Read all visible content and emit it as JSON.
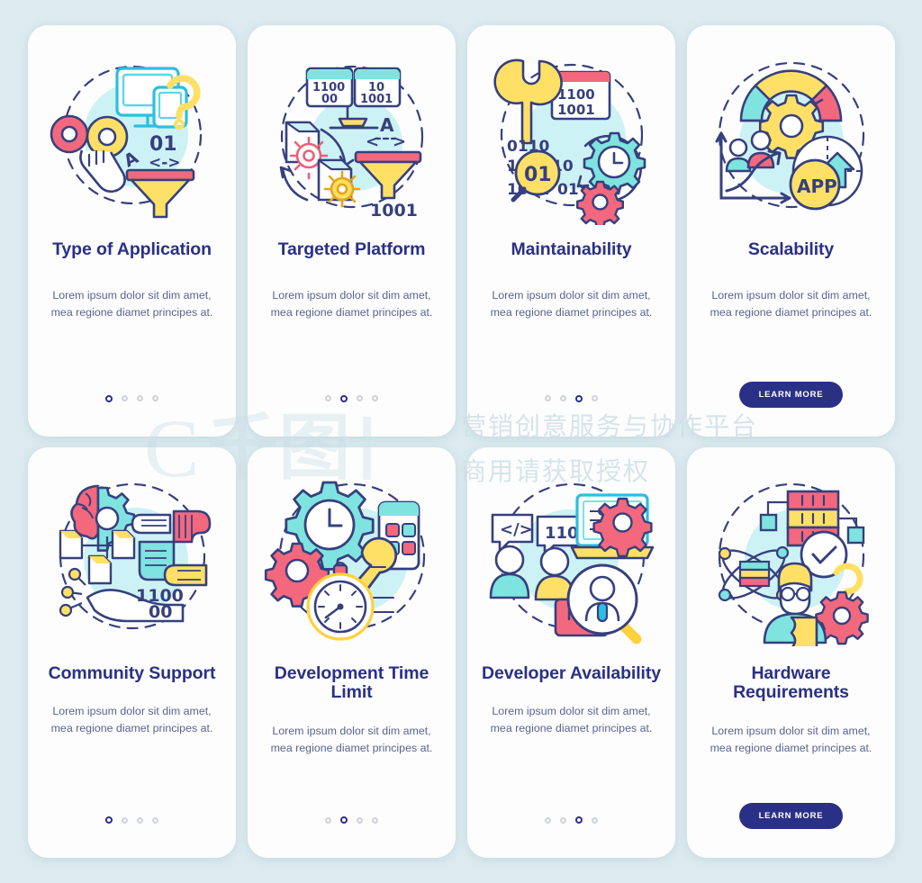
{
  "background_color": "#dbebf0",
  "card_color": "#fdfdfd",
  "accent_color": "#2a3086",
  "title_color": "#2a3086",
  "body_color": "#5a6490",
  "palette": {
    "cyan": "#5bd6e8",
    "teal": "#7fe3e0",
    "yellow": "#ffe066",
    "pink": "#f4687d",
    "navy": "#36407e",
    "light_cyan": "#cdf2f5"
  },
  "cards": [
    {
      "id": "type-of-application",
      "title": "Type of Application",
      "description": "Lorem ipsum dolor sit dim amet, mea regione diamet principes at.",
      "illustration": "monitor-cursor-funnel-icon",
      "dots": 4,
      "active_dot": 1,
      "cta": null
    },
    {
      "id": "targeted-platform",
      "title": "Targeted Platform",
      "description": "Lorem ipsum dolor sit dim amet, mea regione diamet principes at.",
      "illustration": "binary-monitor-files-funnel-icon",
      "dots": 4,
      "active_dot": 2,
      "cta": null
    },
    {
      "id": "maintainability",
      "title": "Maintainability",
      "description": "Lorem ipsum dolor sit dim amet, mea regione diamet principes at.",
      "illustration": "wrench-binary-gear-clock-icon",
      "dots": 4,
      "active_dot": 3,
      "cta": null
    },
    {
      "id": "scalability",
      "title": "Scalability",
      "description": "Lorem ipsum dolor sit dim amet, mea regione diamet principes at.",
      "illustration": "gauge-growth-app-icon",
      "dots": 0,
      "active_dot": 0,
      "cta": "LEARN MORE"
    },
    {
      "id": "community-support",
      "title": "Community Support",
      "description": "Lorem ipsum dolor sit dim amet, mea regione diamet principes at.",
      "illustration": "brain-hands-teamwork-icon",
      "dots": 4,
      "active_dot": 1,
      "cta": null
    },
    {
      "id": "development-time-limit",
      "title": "Development Time Limit",
      "description": "Lorem ipsum dolor sit dim amet, mea regione diamet principes at.",
      "illustration": "gear-clock-stopwatch-wrench-icon",
      "dots": 4,
      "active_dot": 2,
      "cta": null
    },
    {
      "id": "developer-availability",
      "title": "Developer Availability",
      "description": "Lorem ipsum dolor sit dim amet, mea regione diamet principes at.",
      "illustration": "developers-laptop-search-icon",
      "dots": 4,
      "active_dot": 3,
      "cta": null
    },
    {
      "id": "hardware-requirements",
      "title": "Hardware Requirements",
      "description": "Lorem ipsum dolor sit dim amet, mea regione diamet principes at.",
      "illustration": "server-atom-engineer-icon",
      "dots": 0,
      "active_dot": 0,
      "cta": "LEARN MORE"
    }
  ],
  "illustration_text": {
    "card1": [
      "01",
      "A",
      "<->"
    ],
    "card2": [
      "1100",
      "00",
      "10",
      "1001",
      "A",
      "1001"
    ],
    "card3": [
      "1100",
      "1001",
      "0110",
      "10",
      "01",
      "10",
      "1001"
    ],
    "card4": [
      "APP"
    ],
    "card5": [
      "1100",
      "00"
    ],
    "card7": [
      "</>",
      "110"
    ]
  },
  "watermark": {
    "logo_c": "C",
    "logo_qian": "千图",
    "line1": "营销创意服务与协作平台",
    "line2": "商用请获取授权"
  }
}
